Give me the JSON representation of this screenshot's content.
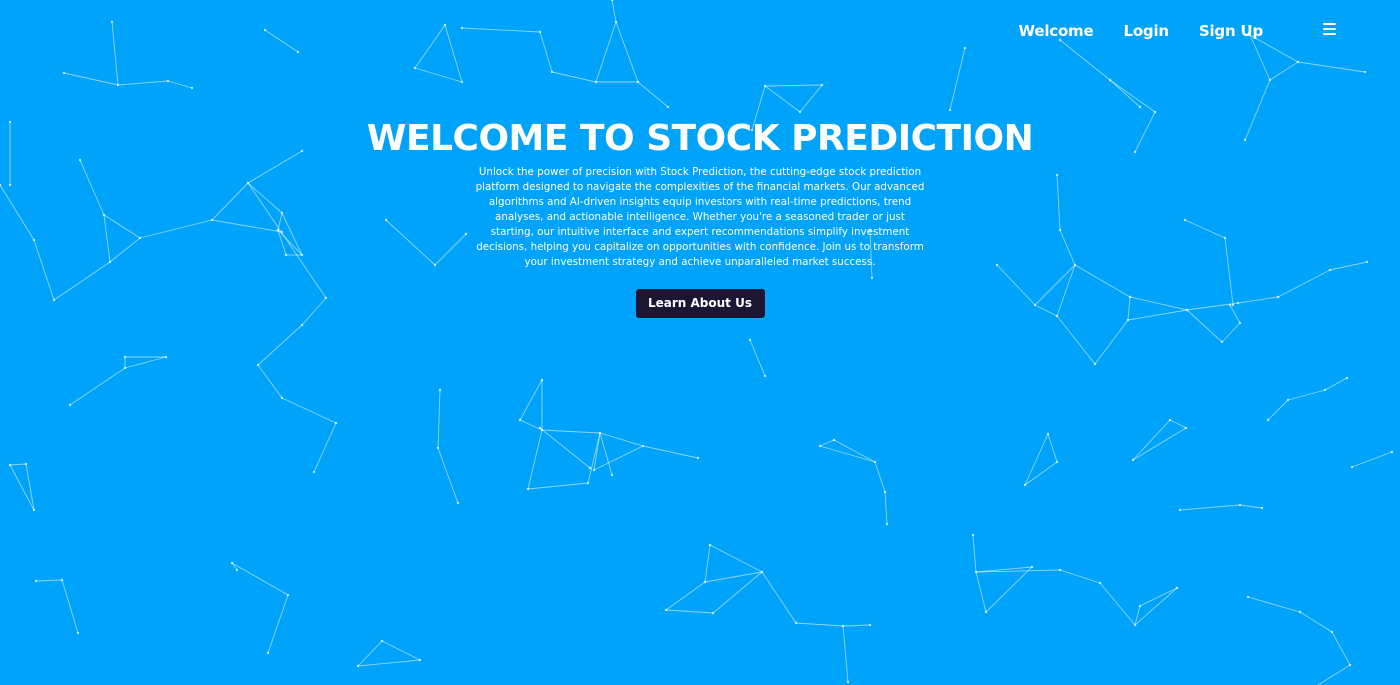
{
  "colors": {
    "background": "#00a3fa",
    "text": "#ffffff",
    "button_bg": "#1c1635"
  },
  "nav": {
    "links": [
      "Welcome",
      "Login",
      "Sign Up"
    ],
    "menu_icon": "hamburger-menu-icon"
  },
  "hero": {
    "title": "WELCOME TO STOCK PREDICTION",
    "description": "Unlock the power of precision with Stock Prediction, the cutting-edge stock prediction platform designed to navigate the complexities of the financial markets. Our advanced algorithms and AI-driven insights equip investors with real-time predictions, trend analyses, and actionable intelligence. Whether you're a seasoned trader or just starting, our intuitive interface and expert recommendations simplify investment decisions, helping you capitalize on opportunities with confidence. Join us to transform your investment strategy and achieve unparalleled market success.",
    "button_label": "Learn About Us"
  }
}
